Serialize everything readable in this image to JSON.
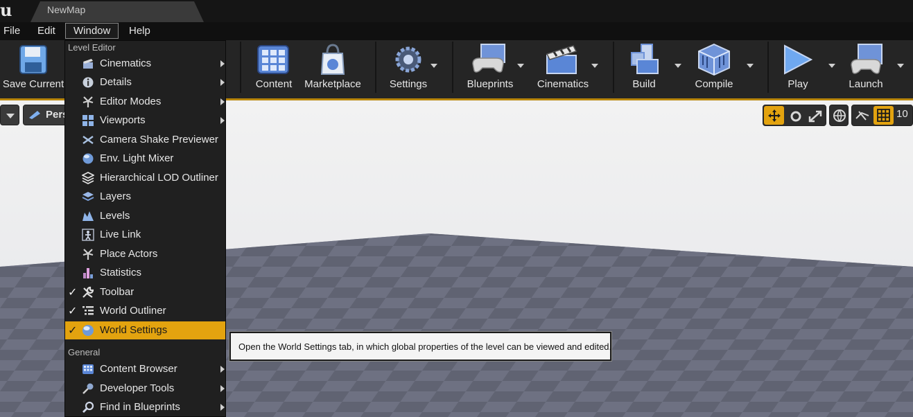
{
  "app": {
    "tab_title": "NewMap",
    "logo": "u"
  },
  "menubar": {
    "items": [
      "File",
      "Edit",
      "Window",
      "Help"
    ]
  },
  "toolbar": {
    "buttons": [
      {
        "label": "Save Current",
        "icon": "floppy-disk-icon"
      },
      {
        "label": "Content",
        "icon": "content-grid-icon"
      },
      {
        "label": "Marketplace",
        "icon": "marketplace-bag-icon"
      },
      {
        "label": "Settings",
        "icon": "gears-icon"
      },
      {
        "label": "Blueprints",
        "icon": "blueprints-gamepad-icon"
      },
      {
        "label": "Cinematics",
        "icon": "clapperboard-icon"
      },
      {
        "label": "Build",
        "icon": "build-blocks-icon"
      },
      {
        "label": "Compile",
        "icon": "compile-cube-icon"
      },
      {
        "label": "Play",
        "icon": "play-icon"
      },
      {
        "label": "Launch",
        "icon": "launch-monitor-icon"
      }
    ]
  },
  "viewport": {
    "perspective_label": "Pers",
    "grid_snap_value": "10"
  },
  "dropdown": {
    "section_level_editor": "Level Editor",
    "level_editor_items": [
      {
        "label": "Cinematics",
        "icon": "cinematics-icon",
        "submenu": true,
        "checked": false
      },
      {
        "label": "Details",
        "icon": "info-icon",
        "submenu": true,
        "checked": false
      },
      {
        "label": "Editor Modes",
        "icon": "editor-modes-icon",
        "submenu": true,
        "checked": false
      },
      {
        "label": "Viewports",
        "icon": "viewports-icon",
        "submenu": true,
        "checked": false
      },
      {
        "label": "Camera Shake Previewer",
        "icon": "camera-shake-icon",
        "submenu": false,
        "checked": false
      },
      {
        "label": "Env. Light Mixer",
        "icon": "light-sphere-icon",
        "submenu": false,
        "checked": false
      },
      {
        "label": "Hierarchical LOD Outliner",
        "icon": "lod-stack-icon",
        "submenu": false,
        "checked": false
      },
      {
        "label": "Layers",
        "icon": "layers-icon",
        "submenu": false,
        "checked": false
      },
      {
        "label": "Levels",
        "icon": "levels-icon",
        "submenu": false,
        "checked": false
      },
      {
        "label": "Live Link",
        "icon": "live-link-icon",
        "submenu": false,
        "checked": false
      },
      {
        "label": "Place Actors",
        "icon": "place-actors-icon",
        "submenu": false,
        "checked": false
      },
      {
        "label": "Statistics",
        "icon": "statistics-icon",
        "submenu": false,
        "checked": false
      },
      {
        "label": "Toolbar",
        "icon": "wrench-icon",
        "submenu": false,
        "checked": true
      },
      {
        "label": "World Outliner",
        "icon": "list-icon",
        "submenu": false,
        "checked": true
      },
      {
        "label": "World Settings",
        "icon": "globe-icon",
        "submenu": false,
        "checked": true,
        "highlighted": true
      }
    ],
    "section_general": "General",
    "general_items": [
      {
        "label": "Content Browser",
        "icon": "content-browser-icon",
        "submenu": true
      },
      {
        "label": "Developer Tools",
        "icon": "developer-tools-icon",
        "submenu": true
      },
      {
        "label": "Find in Blueprints",
        "icon": "search-icon",
        "submenu": true
      }
    ]
  },
  "tooltip": {
    "text": "Open the World Settings tab, in which global properties of the level can be viewed and edited."
  },
  "colors": {
    "accent": "#e3a30f",
    "menu_bg": "#202020",
    "toolbar_bg": "#252525"
  }
}
